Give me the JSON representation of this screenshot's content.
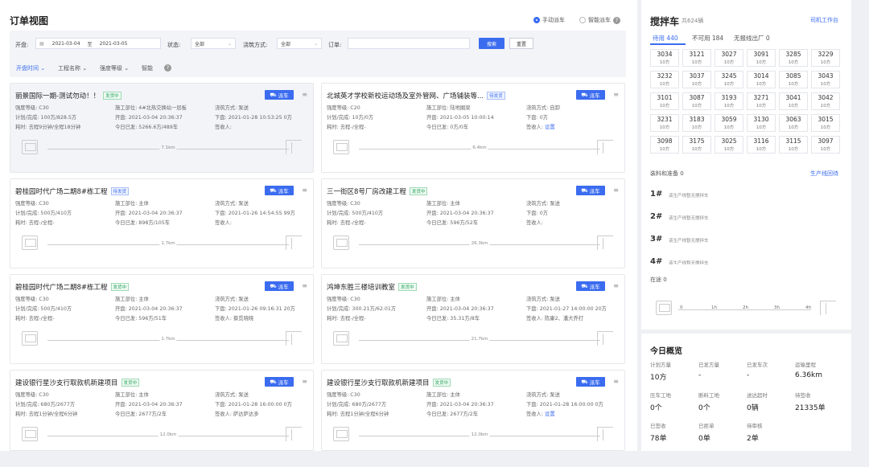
{
  "page": {
    "title": "订单视图"
  },
  "mode": {
    "manual": "手动派车",
    "smart": "智能派车",
    "info": "?"
  },
  "filter": {
    "pour_label": "开盘:",
    "date_from": "2021-03-04",
    "to": "至",
    "date_to": "2021-03-05",
    "status_label": "状态:",
    "status_value": "全部",
    "method_label": "浇筑方式:",
    "method_value": "全部",
    "order_label": "订单:",
    "search": "搜索",
    "reset": "重置"
  },
  "sort": {
    "items": [
      "开盘时间",
      "工程名称",
      "强度等级",
      "智能"
    ],
    "info": "?"
  },
  "cards": [
    {
      "title": "丽景国际一期-测试勿动！！",
      "status": "发货中",
      "status_type": "g",
      "dispatch": "派车",
      "strength": "强度等级: C30",
      "part": "施工部位: 4#北热交换站一层板",
      "method": "浇筑方式: 泵送",
      "plan": "计划/完成: 100方/828.5方",
      "open": "开盘: 2021-03-04 20:36:37",
      "pour": "下盘: 2021-01-28 10:53:25 0方",
      "trips": "耗时: 去程9分钟/全程18分钟",
      "today": "今日已发: 5266.6方/489车",
      "receiver": "签收人:",
      "km": "7.1km",
      "receiver_link": ""
    },
    {
      "title": "北城英才学校新校运动场及室外管网、广场铺装等...",
      "status": "待发货",
      "status_type": "b",
      "dispatch": "派车",
      "strength": "强度等级: C20",
      "part": "施工部位: 陆地圈梁",
      "method": "浇筑方式: 自卸",
      "plan": "计划/完成: 10方/0方",
      "open": "开盘: 2021-03-05 10:00:14",
      "pour": "下盘: 0方",
      "trips": "耗时: 去程-/全程-",
      "today": "今日已发: 0方/0车",
      "receiver": "签收人:",
      "km": "6.4km",
      "receiver_link": "设置"
    },
    {
      "title": "碧桂园时代广场二期8#栋工程",
      "status": "待发货",
      "status_type": "b",
      "dispatch": "派车",
      "strength": "强度等级: C30",
      "part": "施工部位: 主体",
      "method": "浇筑方式: 泵送",
      "plan": "计划/完成: 500方/410方",
      "open": "开盘: 2021-03-04 20:36:37",
      "pour": "下盘: 2021-01-26 14:54:55 99方",
      "trips": "耗时: 去程-/全程-",
      "today": "今日已发: 898方/105车",
      "receiver": "签收人:",
      "km": "1.7km",
      "receiver_link": ""
    },
    {
      "title": "三一街区8号厂房改建工程",
      "status": "发货中",
      "status_type": "g",
      "dispatch": "派车",
      "strength": "强度等级: C30",
      "part": "施工部位: 主体",
      "method": "浇筑方式: 泵送",
      "plan": "计划/完成: 500方/410方",
      "open": "开盘: 2021-03-04 20:36:37",
      "pour": "下盘: 0方",
      "trips": "耗时: 去程-/全程-",
      "today": "今日已发: 596方/52车",
      "receiver": "签收人:",
      "km": "26.3km",
      "receiver_link": ""
    },
    {
      "title": "碧桂园时代广场二期8#栋工程",
      "status": "发货中",
      "status_type": "g",
      "dispatch": "派车",
      "strength": "强度等级: C30",
      "part": "施工部位: 主体",
      "method": "浇筑方式: 泵送",
      "plan": "计划/完成: 500方/410方",
      "open": "开盘: 2021-03-04 20:36:37",
      "pour": "下盘: 2021-01-26 09:16:31 20方",
      "trips": "耗时: 去程-/全程-",
      "today": "今日已发: 596方/51车",
      "receiver": "签收人: 蔡觅晓晓",
      "km": "1.7km",
      "receiver_link": ""
    },
    {
      "title": "鸿坤东胜三楼培训教室",
      "status": "发货中",
      "status_type": "g",
      "dispatch": "派车",
      "strength": "强度等级: C30",
      "part": "施工部位: 主体",
      "method": "浇筑方式: 泵送",
      "plan": "计划/完成: 300.21方/62.01方",
      "open": "开盘: 2021-03-04 20:36:37",
      "pour": "下盘: 2021-01-27 14:00:00 20方",
      "trips": "耗时: 去程-/全程-",
      "today": "今日已发: 35.31方/8车",
      "receiver": "签收人: 陈康2、潘大乔打",
      "km": "21.7km",
      "receiver_link": ""
    },
    {
      "title": "建设银行星沙支行取款机新建项目",
      "status": "发货中",
      "status_type": "g",
      "dispatch": "派车",
      "strength": "强度等级: C30",
      "part": "施工部位: 主体",
      "method": "浇筑方式: 泵送",
      "plan": "计划/完成: 680方/2677方",
      "open": "开盘: 2021-03-04 20:36:37",
      "pour": "下盘: 2021-01-28 16:00:00 0方",
      "trips": "耗时: 去程1分钟/全程6分钟",
      "today": "今日已发: 2677方/2车",
      "receiver": "签收人: 萨达萨达多",
      "km": "12.0km",
      "receiver_link": ""
    },
    {
      "title": "建设银行星沙支行取款机新建项目",
      "status": "发货中",
      "status_type": "g",
      "dispatch": "派车",
      "strength": "强度等级: C30",
      "part": "施工部位: 主体",
      "method": "浇筑方式: 泵送",
      "plan": "计划/完成: 680方/2677方",
      "open": "开盘: 2021-03-04 20:36:37",
      "pour": "下盘: 2021-01-28 16:00:00 0方",
      "trips": "耗时: 去程1分钟/全程6分钟",
      "today": "今日已发: 2677方/2车",
      "receiver": "签收人:",
      "km": "12.0km",
      "receiver_link": "设置"
    }
  ],
  "side": {
    "title": "搅拌车",
    "count": "共624辆",
    "driver_link": "司机工作台",
    "tabs": [
      "待用 440",
      "不可用 184",
      "无报线出厂 0"
    ],
    "trucks": [
      [
        "3034",
        "10方"
      ],
      [
        "3121",
        "10方"
      ],
      [
        "3027",
        "10方"
      ],
      [
        "3091",
        "10方"
      ],
      [
        "3285",
        "10方"
      ],
      [
        "3229",
        "10方"
      ],
      [
        "3232",
        "10方"
      ],
      [
        "3037",
        "10方"
      ],
      [
        "3245",
        "10方"
      ],
      [
        "3014",
        "10方"
      ],
      [
        "3085",
        "10方"
      ],
      [
        "3043",
        "10方"
      ],
      [
        "3101",
        "10方"
      ],
      [
        "3087",
        "10方"
      ],
      [
        "3193",
        "10方"
      ],
      [
        "3271",
        "10方"
      ],
      [
        "3041",
        "10方"
      ],
      [
        "3042",
        "10方"
      ],
      [
        "3231",
        "10方"
      ],
      [
        "3183",
        "10方"
      ],
      [
        "3059",
        "10方"
      ],
      [
        "3130",
        "10方"
      ],
      [
        "3063",
        "10方"
      ],
      [
        "3015",
        "10方"
      ],
      [
        "3098",
        "10方"
      ],
      [
        "3175",
        "10方"
      ],
      [
        "3025",
        "10方"
      ],
      [
        "3116",
        "10方"
      ],
      [
        "3115",
        "10方"
      ],
      [
        "3097",
        "10方"
      ]
    ],
    "loading_label": "装料和准备 0",
    "prod_link": "生产线回待",
    "lines": [
      {
        "no": "1#",
        "text": "该生产线暂无搅拌车"
      },
      {
        "no": "2#",
        "text": "该生产线暂无搅拌车"
      },
      {
        "no": "3#",
        "text": "该生产线暂无搅拌车"
      },
      {
        "no": "4#",
        "text": "该生产线暂无搅拌车"
      }
    ],
    "onroad_label": "在途 0",
    "ticks": [
      "0",
      "1h",
      "2h",
      "3h",
      "4h"
    ]
  },
  "overview": {
    "title": "今日概览",
    "items": [
      {
        "label": "计划方量",
        "value": "10方"
      },
      {
        "label": "已发方量",
        "value": "-"
      },
      {
        "label": "已发车次",
        "value": "-"
      },
      {
        "label": "运输里程",
        "value": "6.36km"
      },
      {
        "label": "压车工地",
        "value": "0个"
      },
      {
        "label": "断料工地",
        "value": "0个"
      },
      {
        "label": "送达超时",
        "value": "0辆"
      },
      {
        "label": "待签收",
        "value": "21335单"
      },
      {
        "label": "已签收",
        "value": "78单"
      },
      {
        "label": "已拒单",
        "value": "0单"
      },
      {
        "label": "待审核",
        "value": "2单"
      }
    ]
  }
}
